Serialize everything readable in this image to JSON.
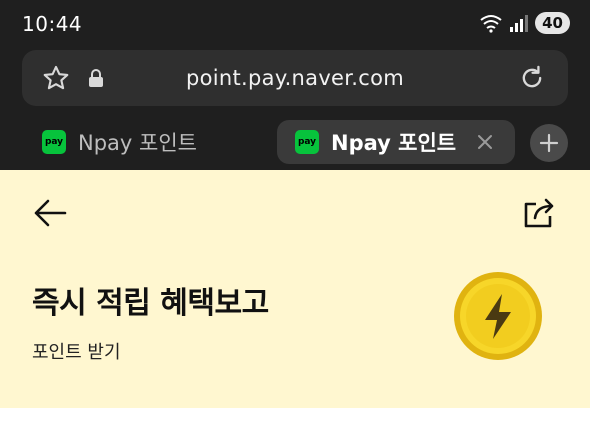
{
  "status_bar": {
    "time": "10:44",
    "battery": "40",
    "icons": [
      "wifi-icon",
      "signal-icon",
      "battery-icon"
    ]
  },
  "browser": {
    "url": "point.pay.naver.com",
    "tabs": [
      {
        "label": "Npay 포인트",
        "badge": "pay",
        "active": false
      },
      {
        "label": "Npay 포인트",
        "badge": "pay",
        "active": true
      }
    ]
  },
  "page": {
    "title": "즉시 적립 혜택보고",
    "subtitle": "포인트 받기",
    "colors": {
      "hero_bg": "#fff7d0",
      "coin": "#f2cd1f",
      "badge": "#07c33c"
    }
  }
}
